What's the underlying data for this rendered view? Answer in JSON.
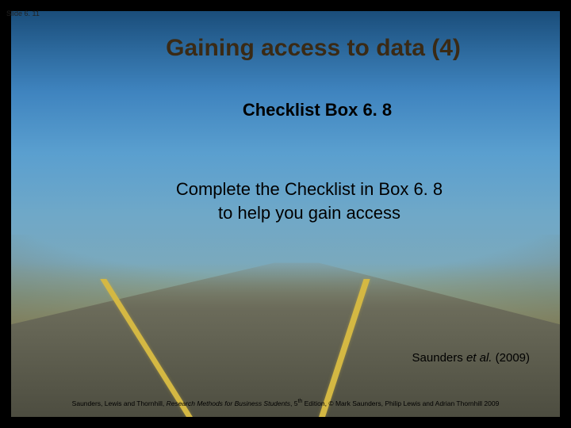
{
  "slide_number": "Slide 6. 11",
  "title": "Gaining access to data (4)",
  "subtitle": "Checklist Box 6. 8",
  "body_line1": "Complete the Checklist in Box 6. 8",
  "body_line2": "to help you gain access",
  "citation_author": "Saunders ",
  "citation_etal": "et al.",
  "citation_year": " (2009)",
  "footer_prefix": "Saunders, Lewis and Thornhill, ",
  "footer_title": "Research Methods for Business Students",
  "footer_edition_pre": ", 5",
  "footer_edition_sup": "th",
  "footer_rest": " Edition, © Mark Saunders, Philip Lewis and Adrian Thornhill 2009"
}
